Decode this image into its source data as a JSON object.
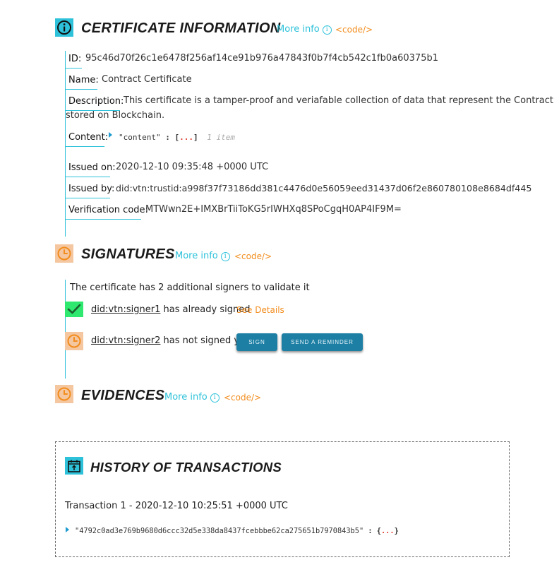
{
  "certificate": {
    "title": "CERTIFICATE INFORMATION",
    "more_info": "More info",
    "code_link": "<code/>",
    "fields": {
      "id_label": "ID:",
      "id_value": "95c46d70f26c1e6478f256af14ce91b976a47843f0b7f4cb542c1fb0a60375b1",
      "name_label": "Name:",
      "name_value": "Contract Certificate",
      "description_label": "Description:",
      "description_line1": "This certificate is a tamper-proof and veriafable collection of data that represent the Contract",
      "description_line2": "stored on Blockchain.",
      "content_label": "Content:",
      "content_key": "\"content\"",
      "content_sep": ":",
      "content_open": "[",
      "content_dots": "...",
      "content_close": "]",
      "content_count": "1 item",
      "issued_on_label": "Issued on:",
      "issued_on_value": "2020-12-10 09:35:48 +0000 UTC",
      "issued_by_label": "Issued by:",
      "issued_by_value": "did:vtn:trustid:a998f37f73186dd381c4476d0e56059eed31437d06f2e860780108e8684df445",
      "verification_label": "Verification code:",
      "verification_value": "MTWwn2E+IMXBrTiiToKG5rIWHXq8SPoCgqH0AP4IF9M="
    }
  },
  "signatures": {
    "title": "SIGNATURES",
    "more_info": "More info",
    "code_link": "<code/>",
    "summary": "The certificate has 2 additional signers to validate it",
    "signer1": {
      "name": "did:vtn:signer1",
      "status": "has already signed",
      "details": "See Details"
    },
    "signer2": {
      "name": "did:vtn:signer2",
      "status": "has not signed yet"
    },
    "sign_button": "SIGN",
    "reminder_button": "SEND A REMINDER"
  },
  "evidences": {
    "title": "EVIDENCES",
    "more_info": "More info",
    "code_link": "<code/>"
  },
  "history": {
    "title": "HISTORY OF TRANSACTIONS",
    "transaction": "Transaction 1 - 2020-12-10 10:25:51 +0000 UTC",
    "tx_key": "\"4792c0ad3e769b9680d6ccc32d5e338da8437fcebbbe62ca275651b7970843b5\"",
    "tx_sep": ":",
    "tx_open": "{",
    "tx_dots": "...",
    "tx_close": "}"
  },
  "colors": {
    "accent_cyan": "#2ec2da",
    "accent_orange": "#f28c1c",
    "pending_bg": "#f5c7a0",
    "success_green": "#2ee86f",
    "button_blue": "#1e7fa4"
  }
}
